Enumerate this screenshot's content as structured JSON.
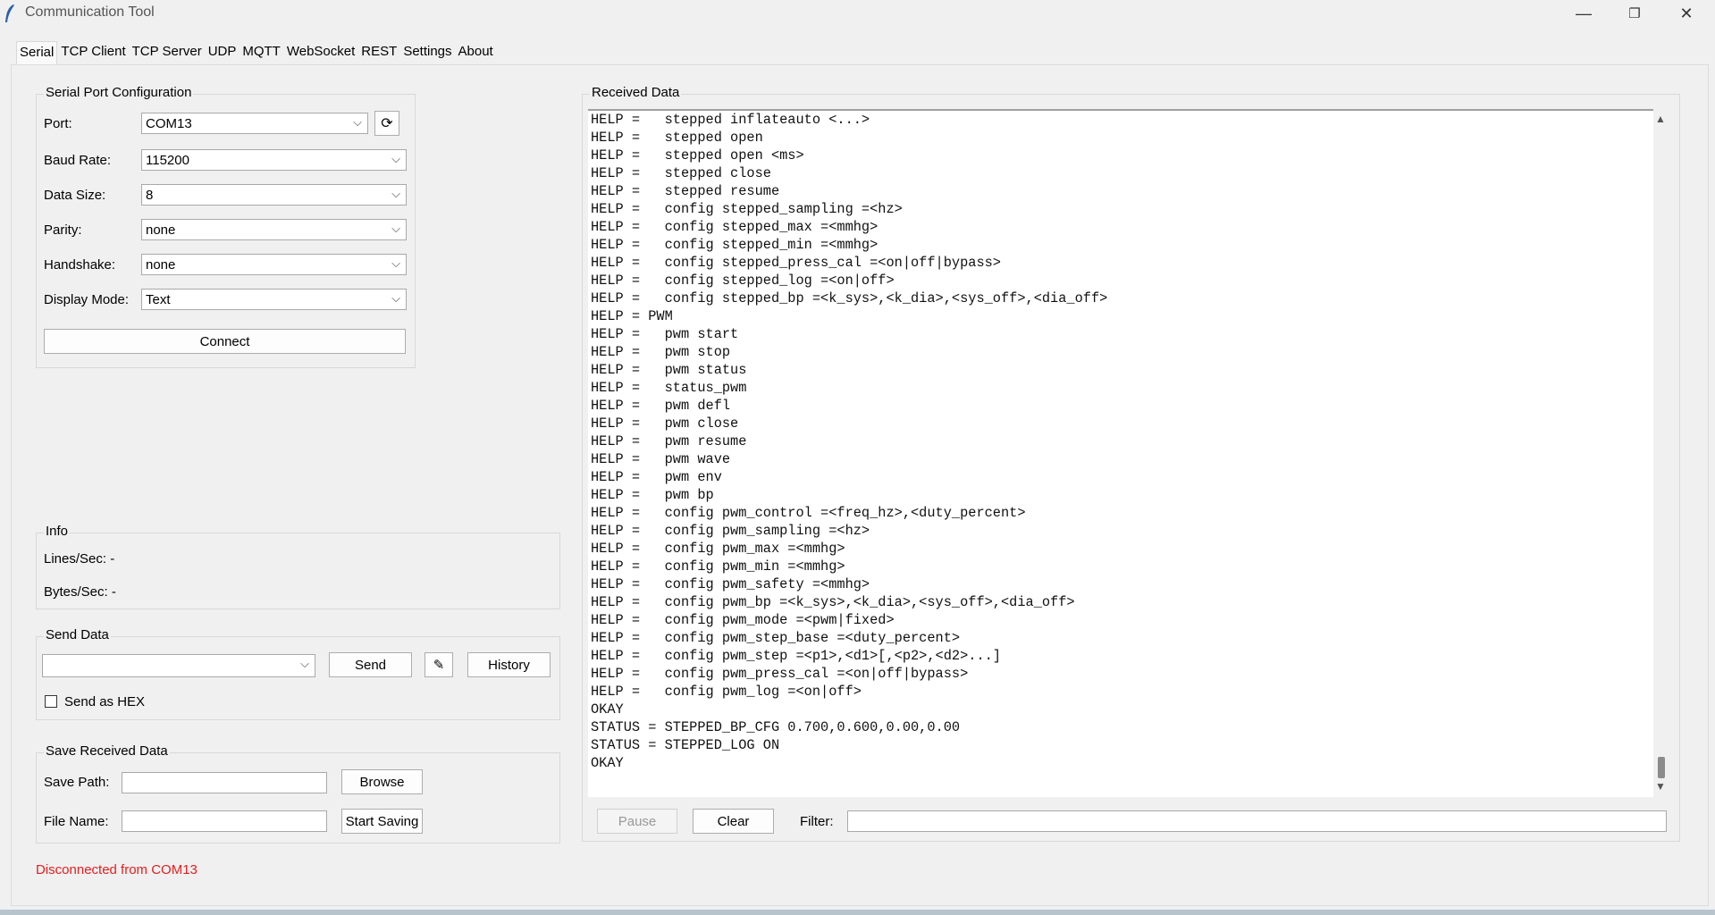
{
  "window": {
    "title": "Communication Tool",
    "minimize": "—",
    "maximize": "❐",
    "close": "✕"
  },
  "tabs": [
    "Serial",
    "TCP Client",
    "TCP Server",
    "UDP",
    "MQTT",
    "WebSocket",
    "REST",
    "Settings",
    "About"
  ],
  "serial_config": {
    "title": "Serial Port Configuration",
    "port_label": "Port:",
    "port_value": "COM13",
    "refresh_icon": "⟳",
    "baud_label": "Baud Rate:",
    "baud_value": "115200",
    "data_size_label": "Data Size:",
    "data_size_value": "8",
    "parity_label": "Parity:",
    "parity_value": "none",
    "handshake_label": "Handshake:",
    "handshake_value": "none",
    "display_mode_label": "Display Mode:",
    "display_mode_value": "Text",
    "connect_label": "Connect"
  },
  "info": {
    "title": "Info",
    "lines_per_sec": "Lines/Sec: -",
    "bytes_per_sec": "Bytes/Sec: -"
  },
  "send_data": {
    "title": "Send Data",
    "input_value": "",
    "send_label": "Send",
    "clear_icon": "✎",
    "history_label": "History",
    "hex_label": "Send as HEX"
  },
  "save_data": {
    "title": "Save Received Data",
    "path_label": "Save Path:",
    "browse_label": "Browse",
    "file_label": "File Name:",
    "start_label": "Start Saving"
  },
  "status": {
    "message": "Disconnected from COM13",
    "color": "#e02020"
  },
  "received": {
    "title": "Received Data",
    "pause_label": "Pause",
    "clear_label": "Clear",
    "filter_label": "Filter:",
    "filter_value": "",
    "lines": [
      "HELP =   stepped inflateauto <...>",
      "HELP =   stepped open",
      "HELP =   stepped open <ms>",
      "HELP =   stepped close",
      "HELP =   stepped resume",
      "HELP =   config stepped_sampling =<hz>",
      "HELP =   config stepped_max =<mmhg>",
      "HELP =   config stepped_min =<mmhg>",
      "HELP =   config stepped_press_cal =<on|off|bypass>",
      "HELP =   config stepped_log =<on|off>",
      "HELP =   config stepped_bp =<k_sys>,<k_dia>,<sys_off>,<dia_off>",
      "HELP = PWM",
      "HELP =   pwm start",
      "HELP =   pwm stop",
      "HELP =   pwm status",
      "HELP =   status_pwm",
      "HELP =   pwm defl",
      "HELP =   pwm close",
      "HELP =   pwm resume",
      "HELP =   pwm wave",
      "HELP =   pwm env",
      "HELP =   pwm bp",
      "HELP =   config pwm_control =<freq_hz>,<duty_percent>",
      "HELP =   config pwm_sampling =<hz>",
      "HELP =   config pwm_max =<mmhg>",
      "HELP =   config pwm_min =<mmhg>",
      "HELP =   config pwm_safety =<mmhg>",
      "HELP =   config pwm_bp =<k_sys>,<k_dia>,<sys_off>,<dia_off>",
      "HELP =   config pwm_mode =<pwm|fixed>",
      "HELP =   config pwm_step_base =<duty_percent>",
      "HELP =   config pwm_step =<p1>,<d1>[,<p2>,<d2>...]",
      "HELP =   config pwm_press_cal =<on|off|bypass>",
      "HELP =   config pwm_log =<on|off>",
      "OKAY",
      "STATUS = STEPPED_BP_CFG 0.700,0.600,0.00,0.00",
      "STATUS = STEPPED_LOG ON",
      "OKAY"
    ]
  }
}
